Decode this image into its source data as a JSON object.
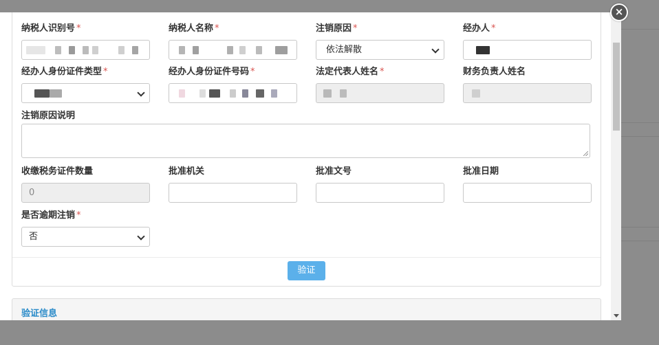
{
  "form": {
    "taxpayer_id": {
      "label": "纳税人识别号",
      "required": "*"
    },
    "taxpayer_name": {
      "label": "纳税人名称",
      "required": "*"
    },
    "cancel_reason": {
      "label": "注销原因",
      "required": "*",
      "value": "依法解散"
    },
    "handler": {
      "label": "经办人",
      "required": "*"
    },
    "handler_id_type": {
      "label": "经办人身份证件类型",
      "required": "*"
    },
    "handler_id_number": {
      "label": "经办人身份证件号码",
      "required": "*"
    },
    "legal_rep_name": {
      "label": "法定代表人姓名",
      "required": "*"
    },
    "finance_head_name": {
      "label": "财务负责人姓名"
    },
    "cancel_reason_desc": {
      "label": "注销原因说明"
    },
    "tax_cert_count": {
      "label": "收缴税务证件数量",
      "value": "0"
    },
    "approval_authority": {
      "label": "批准机关"
    },
    "approval_doc_no": {
      "label": "批准文号"
    },
    "approval_date": {
      "label": "批准日期"
    },
    "overdue_cancel": {
      "label": "是否逾期注销",
      "required": "*",
      "value": "否"
    }
  },
  "buttons": {
    "verify": "验证",
    "close": "×"
  },
  "sections": {
    "verify_info": "验证信息"
  },
  "colors": {
    "primary_button": "#5bb0ea",
    "required": "#d9534f",
    "section_title": "#2a8bc9"
  }
}
